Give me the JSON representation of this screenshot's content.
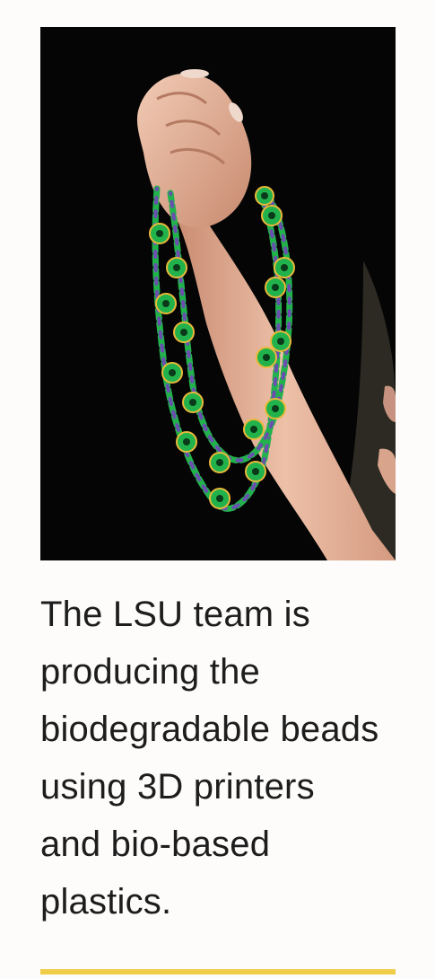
{
  "article": {
    "caption": "The LSU team is producing the biodegradable beads using 3D printers and bio-based plastics."
  },
  "image": {
    "subject": "biodegradable-bead-necklace",
    "colors": {
      "background": "#050505",
      "bead_green": "#22b24c",
      "bead_purple": "#6a4fb0",
      "bead_gold": "#e9b93a",
      "skin": "#e8b9a0"
    }
  },
  "theme": {
    "accent": "#f0cd49",
    "text": "#1d1d1d",
    "page_bg": "#fdfcfb"
  }
}
